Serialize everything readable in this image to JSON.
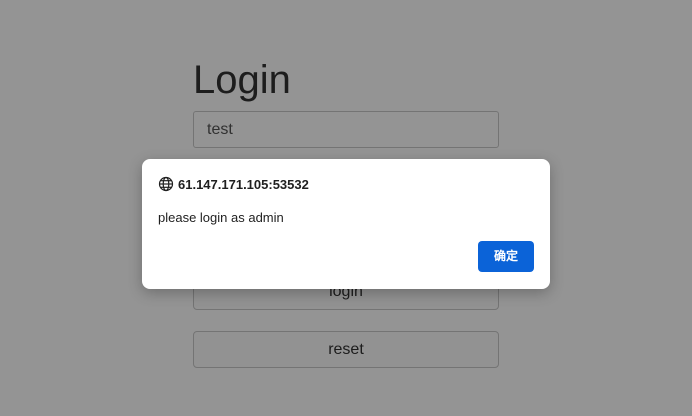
{
  "page": {
    "heading": "Login",
    "username_value": "test",
    "password_value": "",
    "login_label": "login",
    "reset_label": "reset"
  },
  "dialog": {
    "origin": "61.147.171.105:53532",
    "message": "please login as admin",
    "ok_label": "确定",
    "origin_icon": "globe-icon"
  },
  "colors": {
    "ok_button": "#0b63d8",
    "overlay": "rgba(0,0,0,0.42)"
  }
}
